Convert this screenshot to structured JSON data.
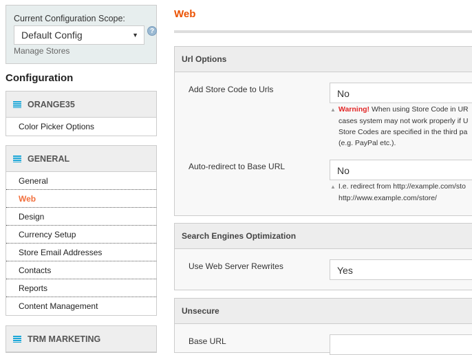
{
  "scope": {
    "label": "Current Configuration Scope:",
    "value": "Default Config",
    "help": "?",
    "manage": "Manage Stores"
  },
  "sidebar": {
    "heading": "Configuration",
    "groups": [
      {
        "title": "ORANGE35",
        "items": [
          "Color Picker Options"
        ]
      },
      {
        "title": "GENERAL",
        "items": [
          "General",
          "Web",
          "Design",
          "Currency Setup",
          "Store Email Addresses",
          "Contacts",
          "Reports",
          "Content Management"
        ]
      },
      {
        "title": "TRM MARKETING",
        "items": []
      }
    ]
  },
  "page": {
    "title": "Web"
  },
  "sections": {
    "url": {
      "title": "Url Options",
      "f1": {
        "label": "Add Store Code to Urls",
        "value": "No",
        "warning": "Warning!",
        "note1": "When using Store Code in UR",
        "note2": "cases system may not work properly if U",
        "note3": "Store Codes are specified in the third pa",
        "note4": "(e.g. PayPal etc.)."
      },
      "f2": {
        "label": "Auto-redirect to Base URL",
        "value": "No",
        "note1": "I.e. redirect from http://example.com/sto",
        "note2": "http://www.example.com/store/"
      }
    },
    "seo": {
      "title": "Search Engines Optimization",
      "f1": {
        "label": "Use Web Server Rewrites",
        "value": "Yes"
      }
    },
    "unsecure": {
      "title": "Unsecure",
      "f1": {
        "label": "Base URL"
      }
    }
  },
  "colors": {
    "accent": "#eb5202",
    "active": "#f26f3c",
    "warning": "#e22626",
    "icon": "#1ba7d8"
  }
}
